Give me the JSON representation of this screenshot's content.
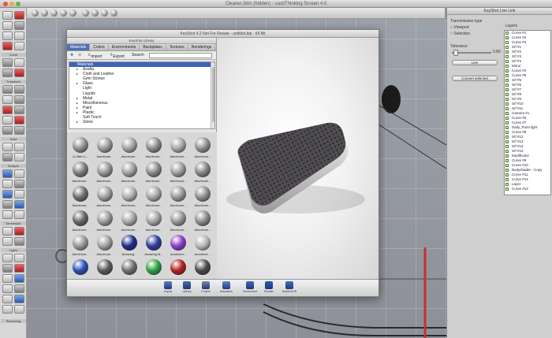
{
  "app_window": {
    "title": "Cleaner.3dm (hidden) - castlThinking Screen 4.0"
  },
  "tool_palette": {
    "labels": [
      "Curve",
      "Transform",
      "Solid",
      "Analyze",
      "Dimension",
      "Lights"
    ],
    "bottom_label": "Rendering"
  },
  "right_panel": {
    "title": "KeyShot Live Link",
    "section_label": "Transmission type",
    "options": [
      "Viewport",
      "Selection"
    ],
    "tessellation_label": "Tolerance",
    "slider_value": "0.80",
    "send_button": "Live",
    "convert_button": "Convert selected",
    "layer_header": "Layers",
    "layers": [
      "Curve #1",
      "Curve #2",
      "Curve #3",
      "Srf #1",
      "Srf #2",
      "Srf #3",
      "Srf #4",
      "Mirror",
      "Curve #4",
      "Curve #5",
      "Srf #5",
      "Srf #6",
      "Srf #7",
      "Srf #8",
      "Srf #9",
      "Srf #10",
      "Srf #11",
      "Camera #1",
      "Curve #6",
      "Curve #7",
      "Daily_Point light",
      "Curve #8",
      "Srf #12",
      "Srf #13",
      "Srf #14",
      "Srf #15",
      "Modificator",
      "Curve #9",
      "Curve #10",
      "Bodyshader - Copy",
      "Curve #11",
      "Curve #12",
      "Layer",
      "Curve #13"
    ]
  },
  "keyshot": {
    "title": "KeyShot 4.2 Not For Resale - untitled.bip - 64 Bit",
    "library": {
      "title": "KeyShot Library",
      "tabs": [
        "Materials",
        "Colors",
        "Environments",
        "Backplates",
        "Textures",
        "Renderings"
      ],
      "toolbar": {
        "import_label": "Import",
        "export_label": "Export",
        "search_label": "Search"
      },
      "folders": [
        {
          "name": "Materials",
          "arrow": "▾",
          "selected": true
        },
        {
          "name": "Axalta",
          "arrow": "▸"
        },
        {
          "name": "Cloth and Leather",
          "arrow": "▸"
        },
        {
          "name": "Gem Stones",
          "arrow": ""
        },
        {
          "name": "Glass",
          "arrow": "▸"
        },
        {
          "name": "Light",
          "arrow": ""
        },
        {
          "name": "Liquids",
          "arrow": ""
        },
        {
          "name": "Metal",
          "arrow": "▸"
        },
        {
          "name": "Miscellaneous",
          "arrow": "▸"
        },
        {
          "name": "Paint",
          "arrow": "▸"
        },
        {
          "name": "Plastic",
          "arrow": "▸"
        },
        {
          "name": "Soft Touch",
          "arrow": ""
        },
        {
          "name": "Stone",
          "arrow": "▸"
        }
      ],
      "materials": [
        {
          "label": "A Little Li...",
          "color": "#8f8f8f"
        },
        {
          "label": "Aluminum...",
          "color": "#9a9a9a"
        },
        {
          "label": "Aluminum...",
          "color": "#a3a3a3"
        },
        {
          "label": "Aluminum...",
          "color": "#8c8c8c"
        },
        {
          "label": "Aluminum...",
          "color": "#a8a8a8"
        },
        {
          "label": "Aluminum...",
          "color": "#909090"
        },
        {
          "label": "Aluminum...",
          "color": "#7d7d7d"
        },
        {
          "label": "Aluminum...",
          "color": "#969696"
        },
        {
          "label": "Aluminum...",
          "color": "#a0a0a0"
        },
        {
          "label": "Aluminum...",
          "color": "#8a8a8a"
        },
        {
          "label": "Aluminum...",
          "color": "#9d9d9d"
        },
        {
          "label": "Aluminum...",
          "color": "#858585"
        },
        {
          "label": "Aluminum...",
          "color": "#6f6f6f"
        },
        {
          "label": "Aluminum...",
          "color": "#9e9e9e"
        },
        {
          "label": "Aluminum...",
          "color": "#b0b0b0"
        },
        {
          "label": "Aluminum...",
          "color": "#a6a6a6"
        },
        {
          "label": "Aluminum...",
          "color": "#989898"
        },
        {
          "label": "Aluminum...",
          "color": "#8e8e8e"
        },
        {
          "label": "Aluminum...",
          "color": "#666666"
        },
        {
          "label": "Aluminum...",
          "color": "#9b9b9b"
        },
        {
          "label": "Aluminum...",
          "color": "#a9a9a9"
        },
        {
          "label": "Aluminum...",
          "color": "#a4a4a4"
        },
        {
          "label": "Aluminum...",
          "color": "#979797"
        },
        {
          "label": "Aluminum...",
          "color": "#8b8b8b"
        },
        {
          "label": "Aluminum...",
          "color": "#999999"
        },
        {
          "label": "Aluminum...",
          "color": "#a1a1a1"
        },
        {
          "label": "Amazing...",
          "color": "#1d2a8a"
        },
        {
          "label": "Amazing M...",
          "color": "#303a9c"
        },
        {
          "label": "Anodized...",
          "color": "#8a3fc4"
        },
        {
          "label": "Anodized ...",
          "color": "#b8b8b8"
        },
        {
          "label": "",
          "color": "#2a4fb8"
        },
        {
          "label": "",
          "color": "#5a5a5a"
        },
        {
          "label": "",
          "color": "#707070"
        },
        {
          "label": "",
          "color": "#2fa043"
        },
        {
          "label": "",
          "color": "#b02020"
        },
        {
          "label": "",
          "color": "#4a4a4a"
        }
      ]
    },
    "bottom_toolbar": [
      {
        "label": "Import",
        "color": "#5a7fc4"
      },
      {
        "label": "Library",
        "color": "#4a6ab0"
      },
      {
        "label": "Project",
        "color": "#7a8aa0"
      },
      {
        "label": "Animation",
        "color": "#5a8ad0"
      },
      {
        "label": "Screenshot",
        "color": "#3a6ac0"
      },
      {
        "label": "Render",
        "color": "#2a5ab4"
      },
      {
        "label": "KeyShotVR",
        "color": "#3a70c8"
      }
    ]
  }
}
